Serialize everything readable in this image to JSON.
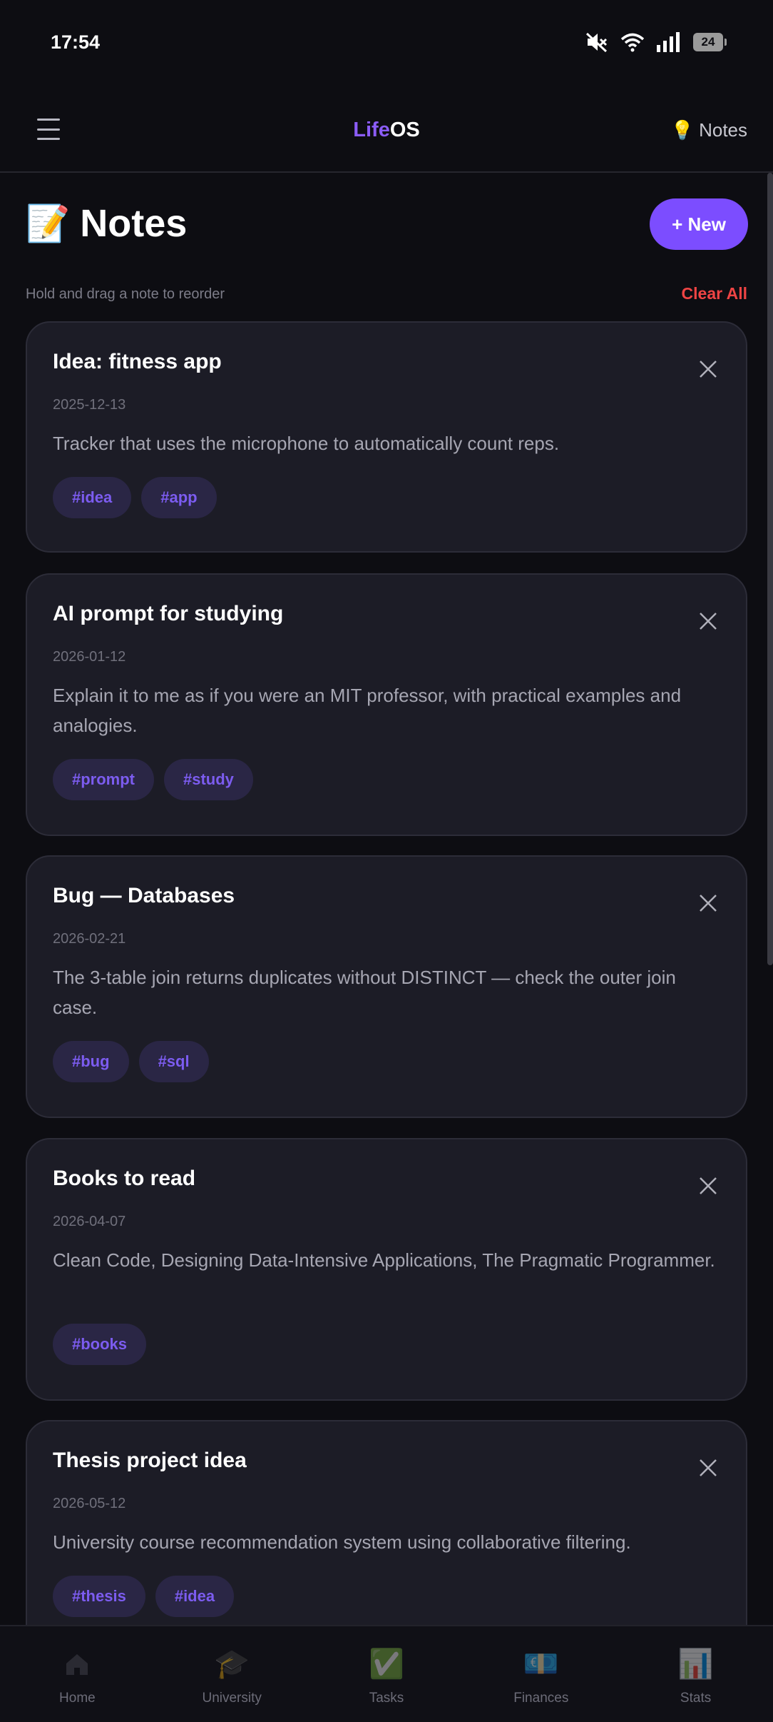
{
  "status_bar": {
    "time": "17:54",
    "battery": "24",
    "icons": [
      "mute-icon",
      "wifi-icon",
      "signal-icon",
      "battery-icon"
    ]
  },
  "header": {
    "brand_part1": "Life",
    "brand_part2": "OS",
    "right_emoji": "💡",
    "right_label": "Notes"
  },
  "page": {
    "title_emoji": "📝",
    "title": "Notes",
    "new_button": "+ New",
    "hint": "Hold and drag a note to reorder",
    "clear_all": "Clear All"
  },
  "notes": [
    {
      "title": "Idea: fitness app",
      "date": "2025-12-13",
      "body": "Tracker that uses the microphone to automatically count reps.",
      "tags": [
        "#idea",
        "#app"
      ]
    },
    {
      "title": "AI prompt for studying",
      "date": "2026-01-12",
      "body": "Explain it to me as if you were an MIT professor, with practical examples and analogies.",
      "tags": [
        "#prompt",
        "#study"
      ]
    },
    {
      "title": "Bug — Databases",
      "date": "2026-02-21",
      "body": "The 3-table join returns duplicates without DISTINCT — check the outer join case.",
      "tags": [
        "#bug",
        "#sql"
      ]
    },
    {
      "title": "Books to read",
      "date": "2026-04-07",
      "body": "Clean Code, Designing Data-Intensive Applications, The Pragmatic Programmer.",
      "tags": [
        "#books"
      ]
    },
    {
      "title": "Thesis project idea",
      "date": "2026-05-12",
      "body": "University course recommendation system using collaborative filtering.",
      "tags": [
        "#thesis",
        "#idea"
      ]
    }
  ],
  "bottom_nav": [
    {
      "label": "Home",
      "icon": "home-icon"
    },
    {
      "label": "University",
      "icon": "🎓"
    },
    {
      "label": "Tasks",
      "icon": "✅"
    },
    {
      "label": "Finances",
      "icon": "💶"
    },
    {
      "label": "Stats",
      "icon": "📊"
    }
  ],
  "colors": {
    "accent": "#7c4dff",
    "danger": "#ef4444",
    "card_bg": "#1c1c26",
    "tag_bg": "#2a2645",
    "tag_text": "#7c5cf0"
  }
}
